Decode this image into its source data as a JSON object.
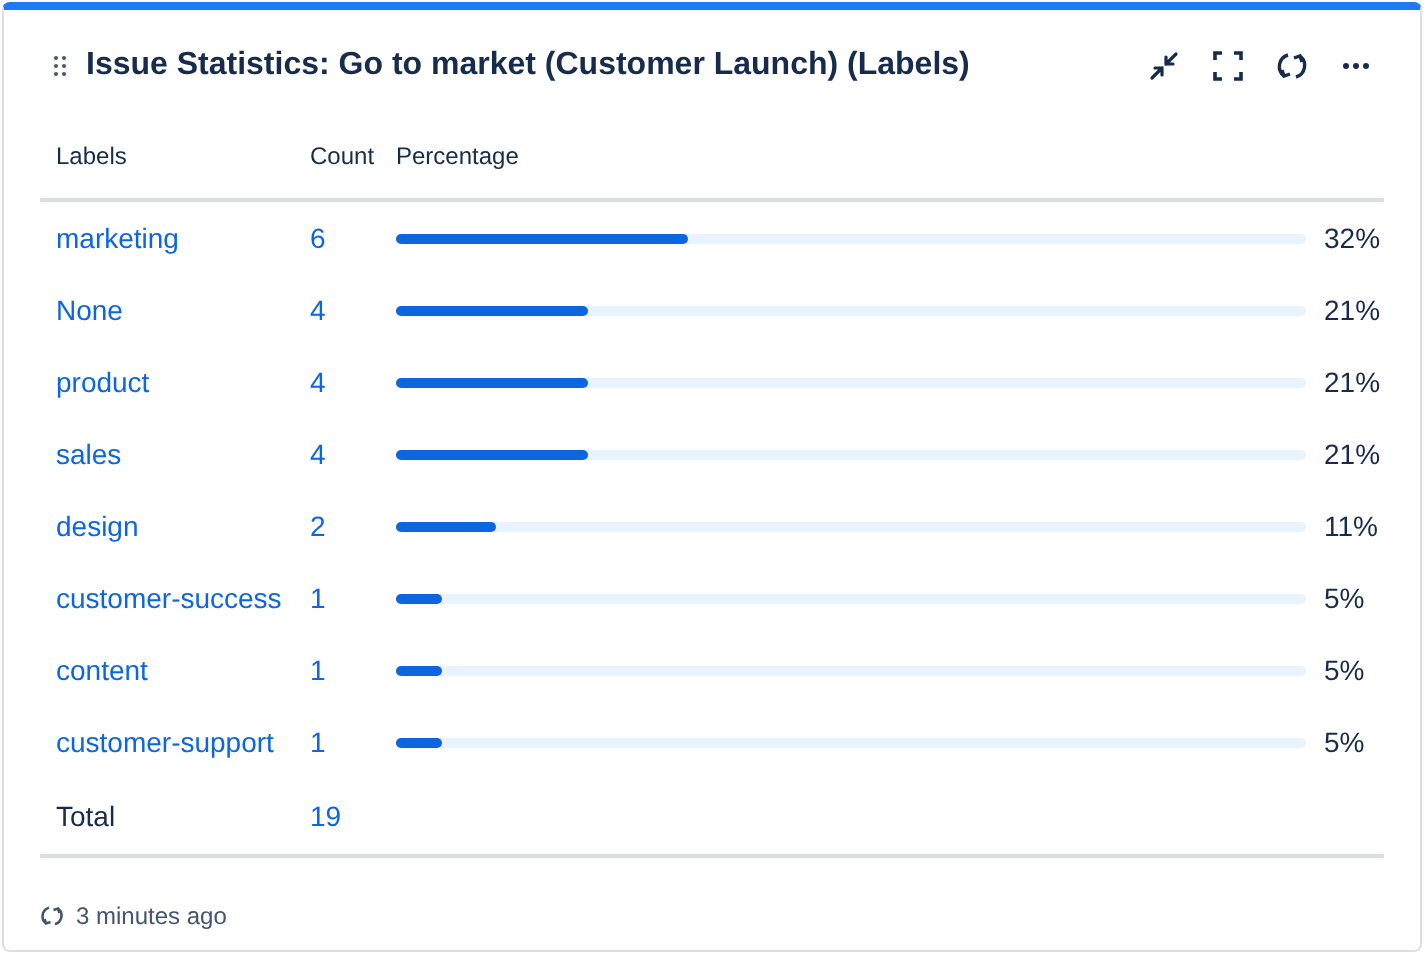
{
  "gadget": {
    "title": "Issue Statistics: Go to market (Customer Launch) (Labels)"
  },
  "table": {
    "columns": [
      "Labels",
      "Count",
      "Percentage"
    ],
    "rows": [
      {
        "label": "marketing",
        "count": "6",
        "level": 0.32,
        "percent": "32%"
      },
      {
        "label": "None",
        "count": "4",
        "level": 0.21,
        "percent": "21%"
      },
      {
        "label": "product",
        "count": "4",
        "level": 0.21,
        "percent": "21%"
      },
      {
        "label": "sales",
        "count": "4",
        "level": 0.21,
        "percent": "21%"
      },
      {
        "label": "design",
        "count": "2",
        "level": 0.11,
        "percent": "11%"
      },
      {
        "label": "customer-success",
        "count": "1",
        "level": 0.05,
        "percent": "5%"
      },
      {
        "label": "content",
        "count": "1",
        "level": 0.05,
        "percent": "5%"
      },
      {
        "label": "customer-support",
        "count": "1",
        "level": 0.05,
        "percent": "5%"
      }
    ],
    "total": {
      "label": "Total",
      "count": "19"
    }
  },
  "footer": {
    "updated": "3 minutes ago"
  }
}
